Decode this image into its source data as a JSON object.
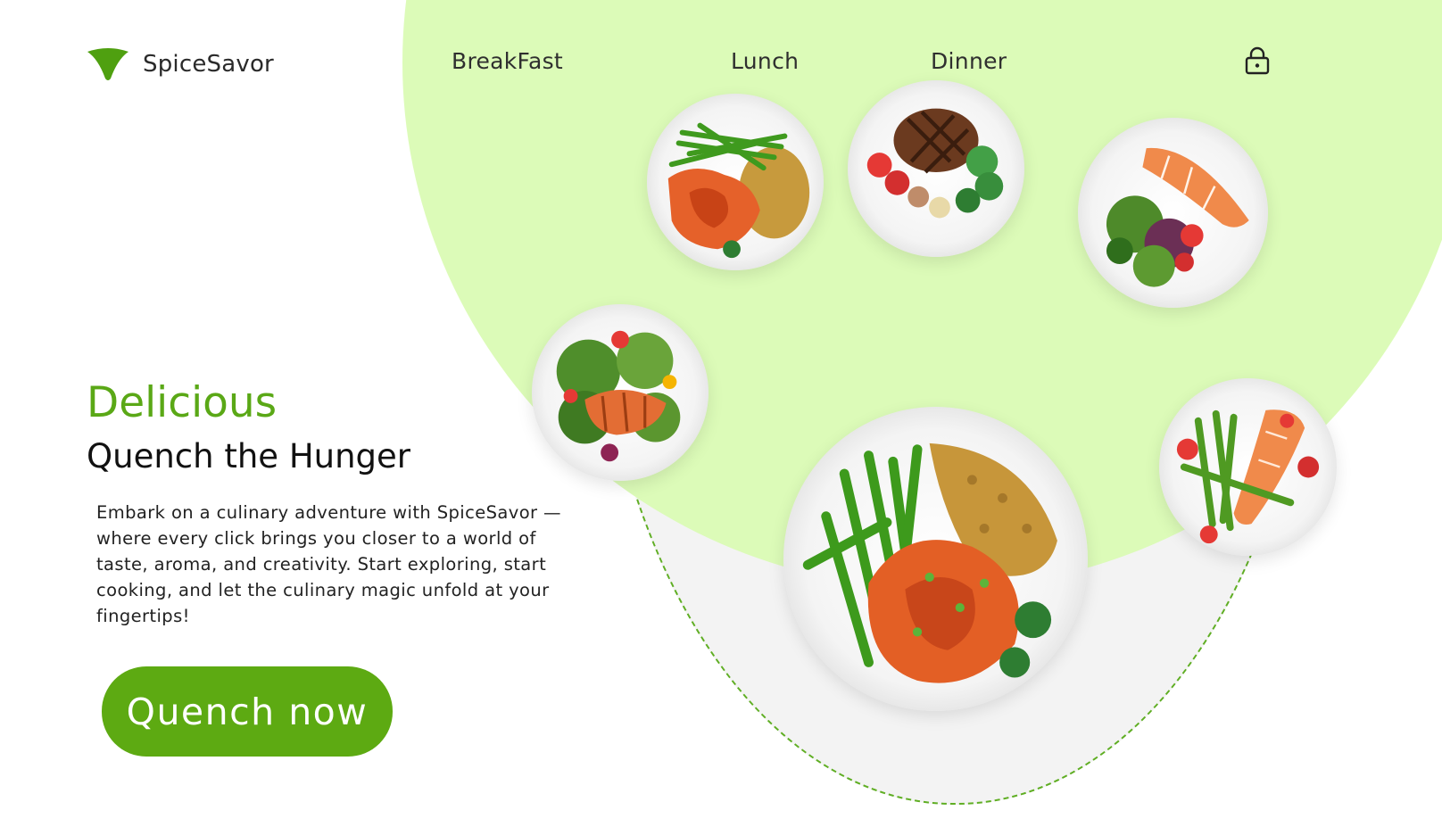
{
  "brand": {
    "name": "SpiceSavor"
  },
  "nav": {
    "items": [
      {
        "label": "BreakFast"
      },
      {
        "label": "Lunch"
      },
      {
        "label": "Dinner"
      }
    ],
    "cart_icon": "lock-bag-icon"
  },
  "hero": {
    "eyebrow": "Delicious",
    "headline": "Quench the Hunger",
    "description": "Embark on a culinary adventure with SpiceSavor — where every click brings you closer to a world of taste, aroma, and creativity. Start exploring, start cooking, and let the culinary magic unfold at your fingertips!",
    "cta_label": "Quench now"
  },
  "dishes": [
    {
      "icon": "chicken-greenbeans-rice-plate"
    },
    {
      "icon": "steak-vegetables-plate"
    },
    {
      "icon": "salmon-salad-plate"
    },
    {
      "icon": "salmon-greens-salad-plate"
    },
    {
      "icon": "salmon-asparagus-plate"
    },
    {
      "icon": "featured-chicken-greenbeans-rice-plate"
    }
  ],
  "colors": {
    "accent": "#5daa12",
    "accent_text": "#5aa816",
    "light_green": "#dcfbb8",
    "soft_grey": "#f3f3f3"
  }
}
